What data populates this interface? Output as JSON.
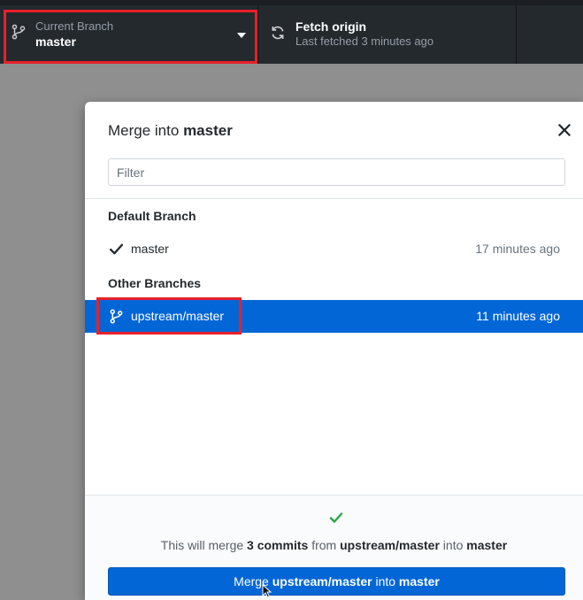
{
  "toolbar": {
    "current_branch": {
      "label": "Current Branch",
      "value": "master",
      "icon": "git-branch-icon"
    },
    "fetch": {
      "title": "Fetch origin",
      "subtitle": "Last fetched 3 minutes ago",
      "icon": "sync-icon"
    }
  },
  "dialog": {
    "title_prefix": "Merge into",
    "title_branch": "master",
    "filter_placeholder": "Filter",
    "filter_value": "",
    "groups": [
      {
        "heading": "Default Branch",
        "branches": [
          {
            "name": "master",
            "time": "17 minutes ago",
            "icon": "check-icon",
            "selected": false
          }
        ]
      },
      {
        "heading": "Other Branches",
        "branches": [
          {
            "name": "upstream/master",
            "time": "11 minutes ago",
            "icon": "git-branch-icon",
            "selected": true
          }
        ]
      }
    ],
    "summary": {
      "part1": "This will merge",
      "commits": "3 commits",
      "part2": "from",
      "source": "upstream/master",
      "part3": "into",
      "target": "master"
    },
    "button": {
      "part1": "Merge",
      "source": "upstream/master",
      "part2": "into",
      "target": "master"
    }
  },
  "colors": {
    "toolbar_bg": "#24292e",
    "accent_blue": "#0366d6",
    "highlight_red": "#e8202a",
    "success_green": "#28a745"
  }
}
